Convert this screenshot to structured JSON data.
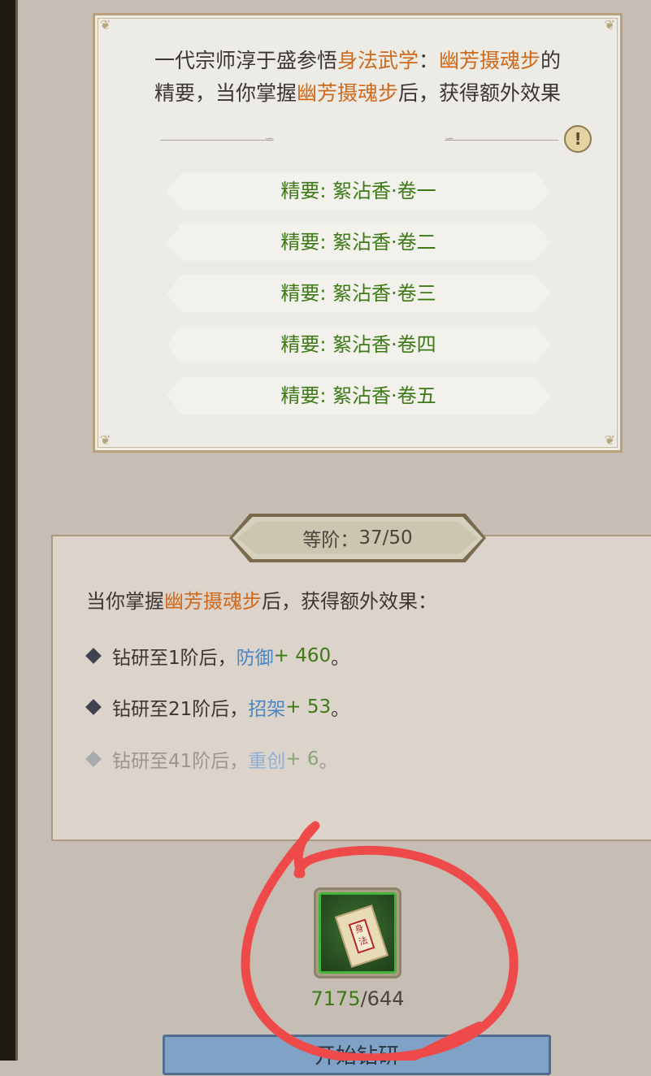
{
  "description": {
    "line1_prefix": "一代宗师淳于盛参悟",
    "category": "身法武学",
    "colon": "：",
    "skill_name": "幽芳摄魂步",
    "line1_suffix": "的",
    "line2_prefix": "精要，当你掌握",
    "line2_skill": "幽芳摄魂步",
    "line2_suffix": "后，获得额外效果"
  },
  "warning_icon": "exclamation-icon",
  "volumes": [
    {
      "label": "精要: 絮沾香·卷一"
    },
    {
      "label": "精要: 絮沾香·卷二"
    },
    {
      "label": "精要: 絮沾香·卷三"
    },
    {
      "label": "精要: 絮沾香·卷四"
    },
    {
      "label": "精要: 絮沾香·卷五"
    }
  ],
  "grade": {
    "label": "等阶：",
    "value": "37/50"
  },
  "effect": {
    "intro_prefix": "当你掌握",
    "skill_name": "幽芳摄魂步",
    "intro_suffix": "后，获得额外效果：",
    "bullets": [
      {
        "prefix": "钻研至1阶后，",
        "stat": "防御",
        "value": " + 460",
        "end": "。",
        "unlocked": true
      },
      {
        "prefix": "钻研至21阶后，",
        "stat": "招架",
        "value": " + 53",
        "end": "。",
        "unlocked": true
      },
      {
        "prefix": "钻研至41阶后，",
        "stat": "重创",
        "value": " + 6",
        "end": "。",
        "unlocked": false
      }
    ]
  },
  "item": {
    "icon": "manual-scroll-icon",
    "seal_text": "身法",
    "count_have": "7175",
    "count_sep": "/",
    "count_need": "644"
  },
  "start_button": {
    "label": "开始钻研"
  },
  "colors": {
    "orange_highlight": "#cf6a1c",
    "green_text": "#3d7a17",
    "blue_stat": "#4a86c4",
    "annotation_red": "#ef4a4a"
  }
}
